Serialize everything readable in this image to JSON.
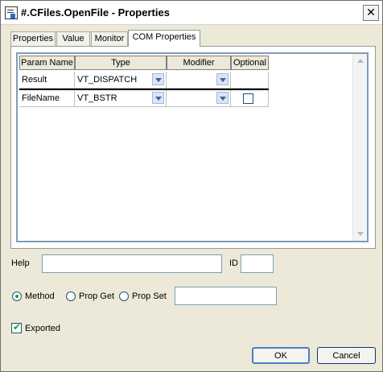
{
  "window": {
    "title": "#.CFiles.OpenFile - Properties",
    "close_glyph": "✕"
  },
  "tabs": [
    {
      "label": "Properties"
    },
    {
      "label": "Value"
    },
    {
      "label": "Monitor"
    },
    {
      "label": "COM Properties",
      "active": true
    }
  ],
  "grid": {
    "columns": [
      "Param Name",
      "Type",
      "Modifier",
      "Optional"
    ],
    "rows": [
      {
        "name": "Result",
        "type": "VT_DISPATCH",
        "modifier": "",
        "optional": null
      },
      {
        "name": "FileName",
        "type": "VT_BSTR",
        "modifier": "",
        "optional": false
      }
    ]
  },
  "help": {
    "label": "Help",
    "value": ""
  },
  "id": {
    "label": "ID",
    "value": ""
  },
  "kind": {
    "options": [
      "Method",
      "Prop Get",
      "Prop Set"
    ],
    "selected": "Method",
    "value": ""
  },
  "exported": {
    "label": "Exported",
    "checked": true,
    "check_glyph": "✔"
  },
  "buttons": {
    "ok": "OK",
    "cancel": "Cancel"
  },
  "colors": {
    "accent": "#1c5180",
    "check": "#1a9b2a",
    "face": "#ece9d8"
  }
}
